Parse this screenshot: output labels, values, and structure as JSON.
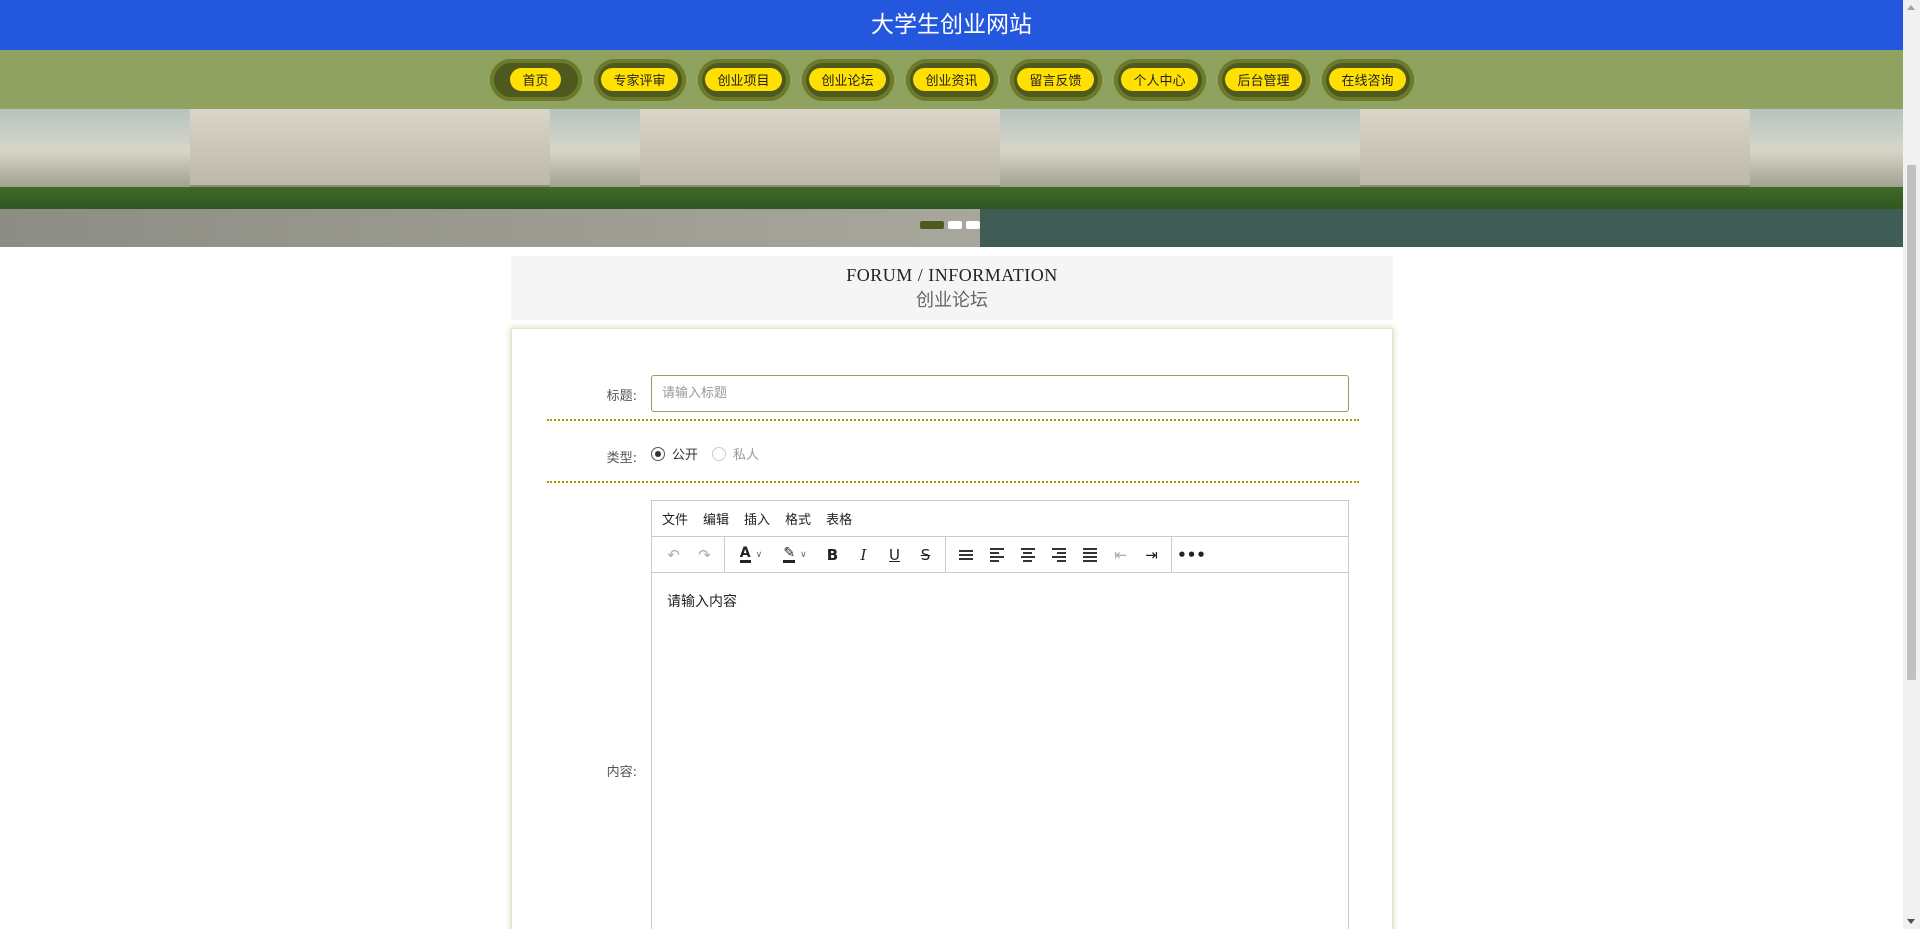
{
  "header": {
    "site_title": "大学生创业网站"
  },
  "nav": {
    "items": [
      {
        "label": "首页"
      },
      {
        "label": "专家评审"
      },
      {
        "label": "创业项目"
      },
      {
        "label": "创业论坛"
      },
      {
        "label": "创业资讯"
      },
      {
        "label": "留言反馈"
      },
      {
        "label": "个人中心"
      },
      {
        "label": "后台管理"
      },
      {
        "label": "在线咨询"
      }
    ]
  },
  "banner": {
    "slide_count": 3,
    "active_slide": 1
  },
  "section": {
    "title_en": "FORUM / INFORMATION",
    "title_cn": "创业论坛"
  },
  "form": {
    "title_label": "标题:",
    "title_placeholder": "请输入标题",
    "title_value": "",
    "type_label": "类型:",
    "type_options": [
      {
        "label": "公开",
        "checked": true
      },
      {
        "label": "私人",
        "checked": false
      }
    ],
    "content_label": "内容:"
  },
  "editor": {
    "menus": [
      "文件",
      "编辑",
      "插入",
      "格式",
      "表格"
    ],
    "placeholder": "请输入内容",
    "toolbar_icons": [
      "undo-icon",
      "redo-icon",
      "text-color-icon",
      "highlight-icon",
      "bold-icon",
      "italic-icon",
      "underline-icon",
      "strikethrough-icon",
      "line-height-icon",
      "align-left-icon",
      "align-center-icon",
      "align-right-icon",
      "align-justify-icon",
      "outdent-icon",
      "indent-icon",
      "more-icon"
    ]
  },
  "colors": {
    "header_bg": "#2357de",
    "nav_bg": "#8fa260",
    "nav_pill": "#ffe000",
    "accent": "#a3a000"
  }
}
